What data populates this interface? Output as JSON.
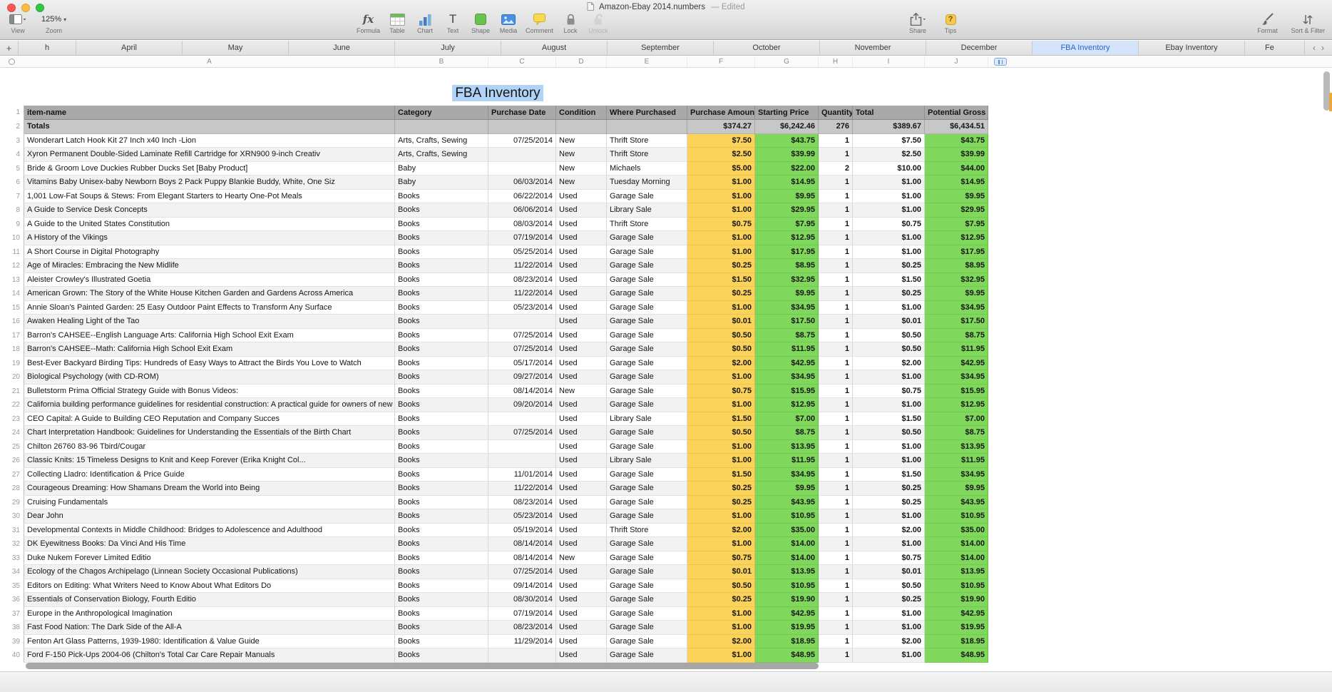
{
  "window": {
    "title": "Amazon-Ebay 2014.numbers",
    "edited_suffix": "— Edited"
  },
  "toolbar": {
    "view": {
      "label": "View"
    },
    "zoom": {
      "label": "Zoom",
      "value": "125%"
    },
    "tools": [
      {
        "id": "formula",
        "label": "Formula",
        "disabled": false
      },
      {
        "id": "table",
        "label": "Table",
        "disabled": false
      },
      {
        "id": "chart",
        "label": "Chart",
        "disabled": false
      },
      {
        "id": "text",
        "label": "Text",
        "disabled": false
      },
      {
        "id": "shape",
        "label": "Shape",
        "disabled": false
      },
      {
        "id": "media",
        "label": "Media",
        "disabled": false
      },
      {
        "id": "comment",
        "label": "Comment",
        "disabled": false
      },
      {
        "id": "lock",
        "label": "Lock",
        "disabled": false
      },
      {
        "id": "unlock",
        "label": "Unlock",
        "disabled": true
      }
    ],
    "share": {
      "label": "Share"
    },
    "tips": {
      "label": "Tips"
    },
    "format": {
      "label": "Format"
    },
    "sort_filter": {
      "label": "Sort & Filter"
    }
  },
  "sheet_tabs": {
    "add_button": "+",
    "partial_left": "h",
    "tabs": [
      "April",
      "May",
      "June",
      "July",
      "August",
      "September",
      "October",
      "November",
      "December",
      "FBA Inventory",
      "Ebay Inventory"
    ],
    "partial_right": "Fe",
    "active": "FBA Inventory",
    "prev_chevron": "‹",
    "next_chevron": "›"
  },
  "column_letters": [
    "A",
    "B",
    "C",
    "D",
    "E",
    "F",
    "G",
    "H",
    "I",
    "J"
  ],
  "table": {
    "title": "FBA Inventory",
    "header_row_num": "1",
    "headers": [
      "item-name",
      "Category",
      "Purchase Date",
      "Condition",
      "Where Purchased",
      "Purchase Amount",
      "Starting Price",
      "Quantity",
      "Total",
      "Potential Gross"
    ],
    "totals_row_num": "2",
    "totals": [
      "Totals",
      "",
      "",
      "",
      "",
      "$374.27",
      "$6,242.46",
      "276",
      "$389.67",
      "$6,434.51"
    ],
    "first_data_row_num": 3,
    "rows": [
      [
        "Wonderart Latch Hook Kit 27 Inch x40 Inch -Lion",
        "Arts, Crafts, Sewing",
        "07/25/2014",
        "New",
        "Thrift Store",
        "$7.50",
        "$43.75",
        "1",
        "$7.50",
        "$43.75"
      ],
      [
        "Xyron Permanent Double-Sided Laminate Refill Cartridge for XRN900 9-inch Creativ",
        "Arts, Crafts, Sewing",
        "",
        "New",
        "Thrift Store",
        "$2.50",
        "$39.99",
        "1",
        "$2.50",
        "$39.99"
      ],
      [
        "Bride & Groom Love Duckies Rubber Ducks Set [Baby Product]",
        "Baby",
        "",
        "New",
        "Michaels",
        "$5.00",
        "$22.00",
        "2",
        "$10.00",
        "$44.00"
      ],
      [
        "Vitamins Baby Unisex-baby Newborn Boys 2 Pack Puppy Blankie Buddy, White, One Siz",
        "Baby",
        "06/03/2014",
        "New",
        "Tuesday Morning",
        "$1.00",
        "$14.95",
        "1",
        "$1.00",
        "$14.95"
      ],
      [
        "1,001 Low-Fat Soups & Stews: From Elegant Starters to Hearty One-Pot Meals",
        "Books",
        "06/22/2014",
        "Used",
        "Garage Sale",
        "$1.00",
        "$9.95",
        "1",
        "$1.00",
        "$9.95"
      ],
      [
        "A Guide to Service Desk Concepts",
        "Books",
        "06/06/2014",
        "Used",
        "Library Sale",
        "$1.00",
        "$29.95",
        "1",
        "$1.00",
        "$29.95"
      ],
      [
        "A Guide to the United States Constitution",
        "Books",
        "08/03/2014",
        "Used",
        "Thrift Store",
        "$0.75",
        "$7.95",
        "1",
        "$0.75",
        "$7.95"
      ],
      [
        "A History of the Vikings",
        "Books",
        "07/19/2014",
        "Used",
        "Garage Sale",
        "$1.00",
        "$12.95",
        "1",
        "$1.00",
        "$12.95"
      ],
      [
        "A Short Course in Digital Photography",
        "Books",
        "05/25/2014",
        "Used",
        "Garage Sale",
        "$1.00",
        "$17.95",
        "1",
        "$1.00",
        "$17.95"
      ],
      [
        "Age of Miracles: Embracing the New Midlife",
        "Books",
        "11/22/2014",
        "Used",
        "Garage Sale",
        "$0.25",
        "$8.95",
        "1",
        "$0.25",
        "$8.95"
      ],
      [
        "Aleister Crowley's Illustrated Goetia",
        "Books",
        "08/23/2014",
        "Used",
        "Garage Sale",
        "$1.50",
        "$32.95",
        "1",
        "$1.50",
        "$32.95"
      ],
      [
        "American Grown: The Story of the White House Kitchen Garden and Gardens Across America",
        "Books",
        "11/22/2014",
        "Used",
        "Garage Sale",
        "$0.25",
        "$9.95",
        "1",
        "$0.25",
        "$9.95"
      ],
      [
        "Annie Sloan's Painted Garden: 25 Easy Outdoor Paint Effects to Transform Any Surface",
        "Books",
        "05/23/2014",
        "Used",
        "Garage Sale",
        "$1.00",
        "$34.95",
        "1",
        "$1.00",
        "$34.95"
      ],
      [
        "Awaken Healing Light of the Tao",
        "Books",
        "",
        "Used",
        "Garage Sale",
        "$0.01",
        "$17.50",
        "1",
        "$0.01",
        "$17.50"
      ],
      [
        "Barron's CAHSEE--English Language Arts: California High School Exit Exam",
        "Books",
        "07/25/2014",
        "Used",
        "Garage Sale",
        "$0.50",
        "$8.75",
        "1",
        "$0.50",
        "$8.75"
      ],
      [
        "Barron's CAHSEE--Math: California High School Exit Exam",
        "Books",
        "07/25/2014",
        "Used",
        "Garage Sale",
        "$0.50",
        "$11.95",
        "1",
        "$0.50",
        "$11.95"
      ],
      [
        "Best-Ever Backyard Birding Tips: Hundreds of Easy Ways to Attract the Birds You Love to Watch",
        "Books",
        "05/17/2014",
        "Used",
        "Garage Sale",
        "$2.00",
        "$42.95",
        "1",
        "$2.00",
        "$42.95"
      ],
      [
        "Biological Psychology (with CD-ROM)",
        "Books",
        "09/27/2014",
        "Used",
        "Garage Sale",
        "$1.00",
        "$34.95",
        "1",
        "$1.00",
        "$34.95"
      ],
      [
        "Bulletstorm Prima Official Strategy Guide with Bonus Videos:",
        "Books",
        "08/14/2014",
        "New",
        "Garage Sale",
        "$0.75",
        "$15.95",
        "1",
        "$0.75",
        "$15.95"
      ],
      [
        "California building performance guidelines for residential construction: A practical guide for owners of new homes : constr",
        "Books",
        "09/20/2014",
        "Used",
        "Garage Sale",
        "$1.00",
        "$12.95",
        "1",
        "$1.00",
        "$12.95"
      ],
      [
        "CEO Capital: A Guide to Building CEO Reputation and Company Succes",
        "Books",
        "",
        "Used",
        "Library Sale",
        "$1.50",
        "$7.00",
        "1",
        "$1.50",
        "$7.00"
      ],
      [
        "Chart Interpretation Handbook: Guidelines for Understanding the Essentials of the Birth Chart",
        "Books",
        "07/25/2014",
        "Used",
        "Garage Sale",
        "$0.50",
        "$8.75",
        "1",
        "$0.50",
        "$8.75"
      ],
      [
        "Chilton 26760 83-96 Tbird/Cougar",
        "Books",
        "",
        "Used",
        "Garage Sale",
        "$1.00",
        "$13.95",
        "1",
        "$1.00",
        "$13.95"
      ],
      [
        "Classic Knits: 15 Timeless Designs to Knit and Keep Forever (Erika Knight Col...",
        "Books",
        "",
        "Used",
        "Library Sale",
        "$1.00",
        "$11.95",
        "1",
        "$1.00",
        "$11.95"
      ],
      [
        "Collecting Lladro: Identification & Price Guide",
        "Books",
        "11/01/2014",
        "Used",
        "Garage Sale",
        "$1.50",
        "$34.95",
        "1",
        "$1.50",
        "$34.95"
      ],
      [
        "Courageous Dreaming: How Shamans Dream the World into Being",
        "Books",
        "11/22/2014",
        "Used",
        "Garage Sale",
        "$0.25",
        "$9.95",
        "1",
        "$0.25",
        "$9.95"
      ],
      [
        "Cruising Fundamentals",
        "Books",
        "08/23/2014",
        "Used",
        "Garage Sale",
        "$0.25",
        "$43.95",
        "1",
        "$0.25",
        "$43.95"
      ],
      [
        "Dear John",
        "Books",
        "05/23/2014",
        "Used",
        "Garage Sale",
        "$1.00",
        "$10.95",
        "1",
        "$1.00",
        "$10.95"
      ],
      [
        "Developmental Contexts in Middle Childhood: Bridges to Adolescence and Adulthood",
        "Books",
        "05/19/2014",
        "Used",
        "Thrift Store",
        "$2.00",
        "$35.00",
        "1",
        "$2.00",
        "$35.00"
      ],
      [
        "DK Eyewitness Books: Da Vinci And His Time",
        "Books",
        "08/14/2014",
        "Used",
        "Garage Sale",
        "$1.00",
        "$14.00",
        "1",
        "$1.00",
        "$14.00"
      ],
      [
        "Duke Nukem Forever Limited Editio",
        "Books",
        "08/14/2014",
        "New",
        "Garage Sale",
        "$0.75",
        "$14.00",
        "1",
        "$0.75",
        "$14.00"
      ],
      [
        "Ecology of the Chagos Archipelago (Linnean Society Occasional Publications)",
        "Books",
        "07/25/2014",
        "Used",
        "Garage Sale",
        "$0.01",
        "$13.95",
        "1",
        "$0.01",
        "$13.95"
      ],
      [
        "Editors on Editing: What Writers Need to Know About What Editors Do",
        "Books",
        "09/14/2014",
        "Used",
        "Garage Sale",
        "$0.50",
        "$10.95",
        "1",
        "$0.50",
        "$10.95"
      ],
      [
        "Essentials of Conservation Biology, Fourth Editio",
        "Books",
        "08/30/2014",
        "Used",
        "Garage Sale",
        "$0.25",
        "$19.90",
        "1",
        "$0.25",
        "$19.90"
      ],
      [
        "Europe in the Anthropological Imagination",
        "Books",
        "07/19/2014",
        "Used",
        "Garage Sale",
        "$1.00",
        "$42.95",
        "1",
        "$1.00",
        "$42.95"
      ],
      [
        "Fast Food Nation: The Dark Side of the All-A",
        "Books",
        "08/23/2014",
        "Used",
        "Garage Sale",
        "$1.00",
        "$19.95",
        "1",
        "$1.00",
        "$19.95"
      ],
      [
        "Fenton Art Glass Patterns, 1939-1980: Identification & Value Guide",
        "Books",
        "11/29/2014",
        "Used",
        "Garage Sale",
        "$2.00",
        "$18.95",
        "1",
        "$2.00",
        "$18.95"
      ],
      [
        "Ford F-150 Pick-Ups 2004-06 (Chilton's Total Car Care Repair Manuals",
        "Books",
        "",
        "Used",
        "Garage Sale",
        "$1.00",
        "$48.95",
        "1",
        "$1.00",
        "$48.95"
      ]
    ]
  },
  "colors": {
    "purchase_amount_bg": "#fbd25a",
    "price_green_bg": "#7fd75b",
    "header_gray": "#a9a9a9",
    "totals_gray": "#c7c7c7",
    "active_tab_bg": "#d3e3f9",
    "selection_blue": "#b0d3f7"
  }
}
